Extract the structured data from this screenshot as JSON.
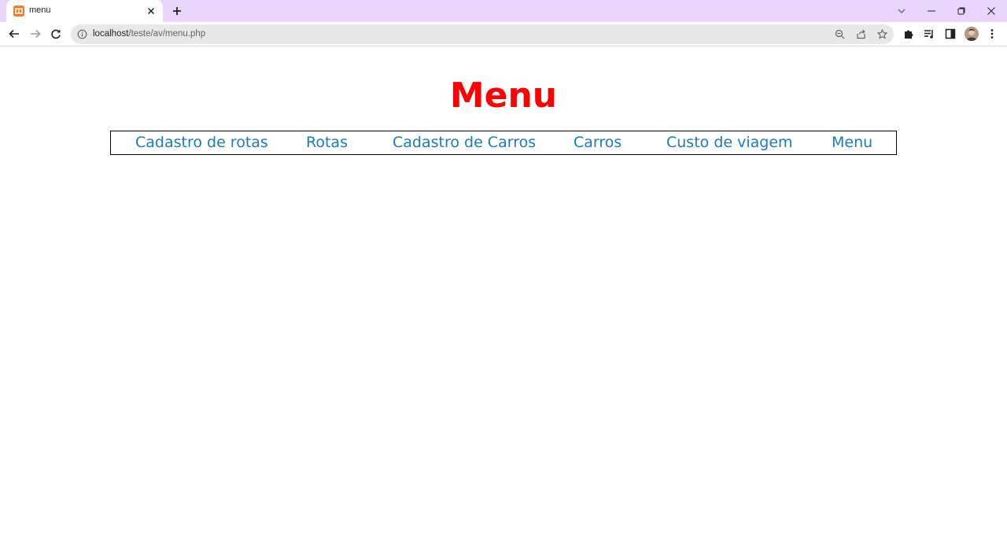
{
  "browser": {
    "tab": {
      "title": "menu",
      "favicon": "xampp-icon"
    },
    "address": {
      "host": "localhost",
      "path": "/teste/av/menu.php"
    }
  },
  "page": {
    "title": "Menu",
    "title_color": "#ff0000",
    "link_color": "#1a7bc0",
    "nav": [
      {
        "label": "Cadastro de rotas"
      },
      {
        "label": "Rotas"
      },
      {
        "label": "Cadastro de Carros"
      },
      {
        "label": "Carros"
      },
      {
        "label": "Custo de viagem"
      },
      {
        "label": "Menu"
      }
    ]
  }
}
